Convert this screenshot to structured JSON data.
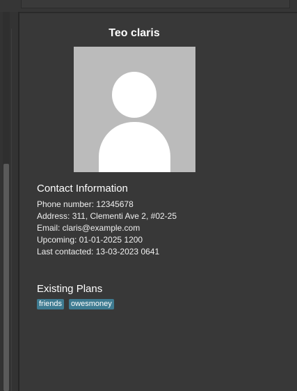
{
  "contact": {
    "name": "Teo claris",
    "avatar_icon": "default-user-avatar-icon"
  },
  "contact_info": {
    "heading": "Contact Information",
    "phone": "Phone number: 12345678",
    "address": "Address: 311, Clementi Ave 2, #02-25",
    "email": "Email: claris@example.com",
    "upcoming": "Upcoming: 01-01-2025 1200",
    "last_contacted": "Last contacted: 13-03-2023 0641"
  },
  "plans": {
    "heading": "Existing Plans",
    "tags": [
      "friends",
      "owesmoney"
    ]
  },
  "colors": {
    "background": "#383838",
    "tag_background": "#3e7b91",
    "avatar_background": "#bbbbbb"
  }
}
